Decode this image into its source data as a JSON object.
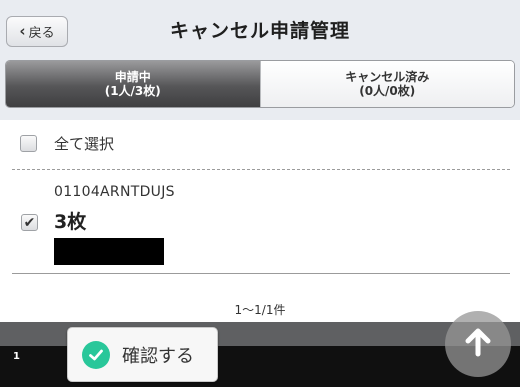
{
  "header": {
    "back_label": "戻る",
    "title": "キャンセル申請管理"
  },
  "tabs": [
    {
      "label": "申請中",
      "count": "(1人/3枚)",
      "active": true
    },
    {
      "label": "キャンセル済み",
      "count": "(0人/0枚)",
      "active": false
    }
  ],
  "select_all": {
    "label": "全て選択",
    "checked": false
  },
  "items": [
    {
      "code": "01104ARNTDUJS",
      "quantity": "3枚",
      "checked": true
    }
  ],
  "pager": "1〜1/1件",
  "footer": {
    "page_number": "1",
    "confirm_label": "確認する"
  },
  "colors": {
    "confirm_check": "#29c79a",
    "active_tab": "#565658",
    "background": "#e9ecf1"
  },
  "icons": {
    "back": "chevron-left-icon",
    "confirm": "check-circle-icon",
    "scroll_top": "arrow-up-icon"
  }
}
